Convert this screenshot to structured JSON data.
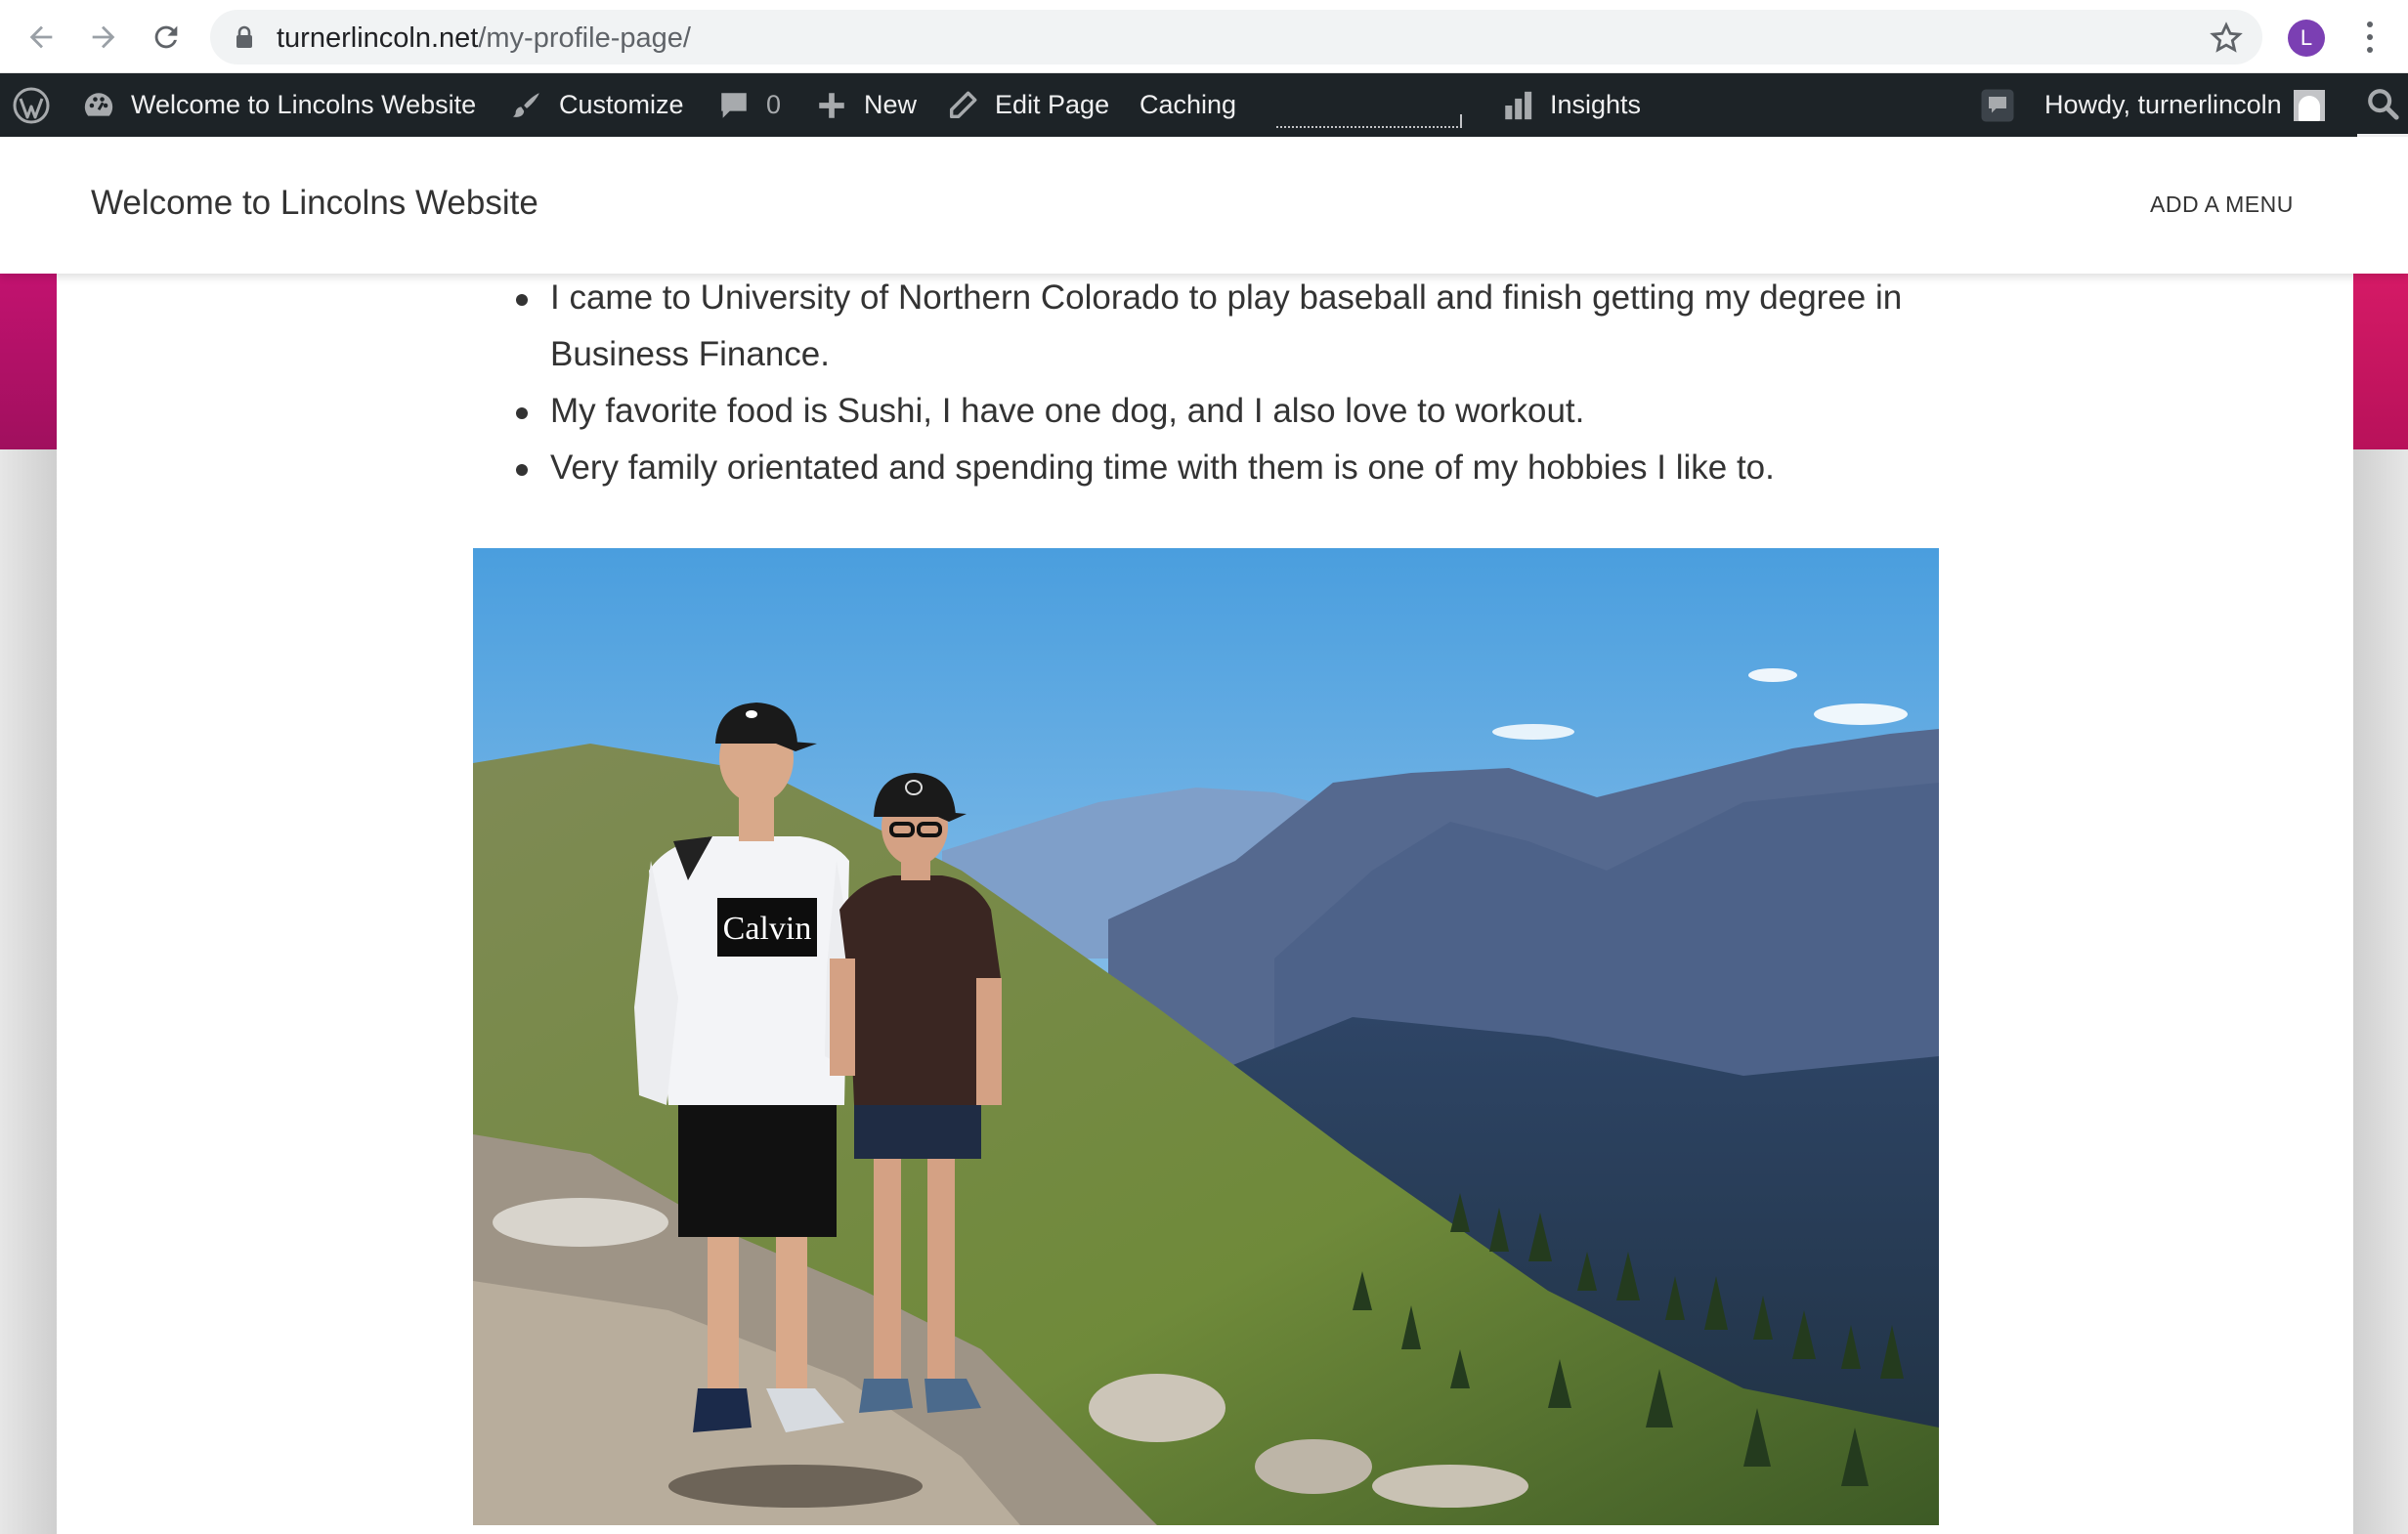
{
  "browser": {
    "url_host": "turnerlincoln.net",
    "url_path": "/my-profile-page/",
    "profile_initial": "L"
  },
  "admin_bar": {
    "site_name": "Welcome to Lincolns Website",
    "customize": "Customize",
    "comments_count": "0",
    "new": "New",
    "edit_page": "Edit Page",
    "caching": "Caching",
    "insights": "Insights",
    "howdy": "Howdy, turnerlincoln"
  },
  "header": {
    "site_title": "Welcome to Lincolns Website",
    "menu_link": "ADD A MENU"
  },
  "content": {
    "bullets": [
      "I came to University of Northern Colorado to play baseball and finish getting my degree in Business Finance.",
      "My favorite food is Sushi, I have one dog, and I also love to workout.",
      "Very family orientated and spending time with them is one of my hobbies I like to."
    ]
  },
  "photo": {
    "shirt_text": "Calvin"
  },
  "colors": {
    "admin_bar": "#1d2327",
    "accent_pink": "#c2126f",
    "text": "#333333"
  }
}
